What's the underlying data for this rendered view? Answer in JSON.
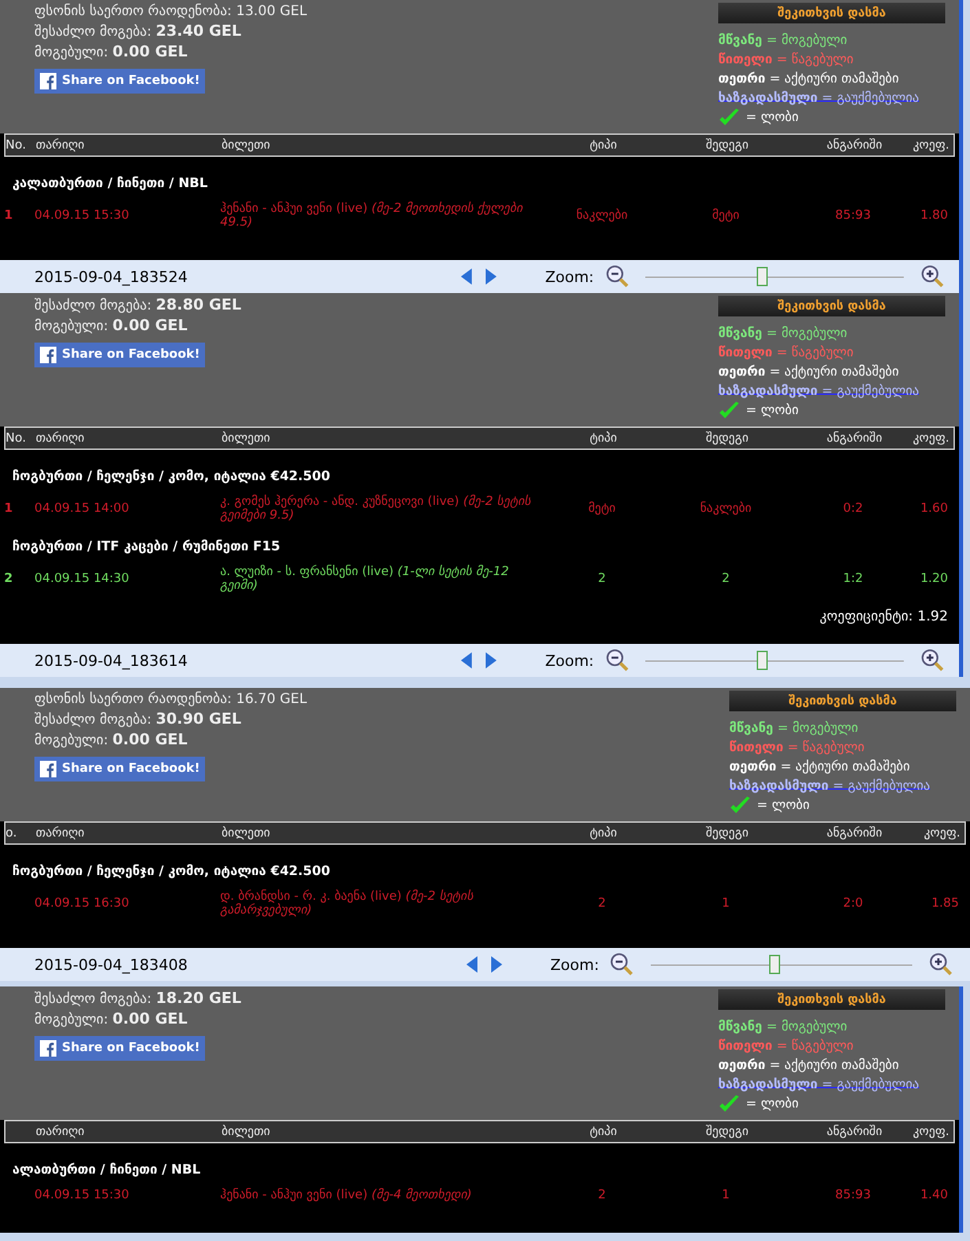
{
  "screens": [
    {
      "summary": [
        {
          "label": "ფსონის საერთო რაოდენობა:",
          "value": "13.00 GEL",
          "bold": false
        },
        {
          "label": "შესაძლო მოგება:",
          "value": "23.40 GEL",
          "bold": true
        },
        {
          "label": "მოგებული:",
          "value": "0.00 GEL",
          "bold": true
        }
      ],
      "share_button": "Share on Facebook!",
      "ask_button": "შეკითხვის დასმა",
      "legend": [
        {
          "kind": "won",
          "term": "მწვანე",
          "desc": "= მოგებული"
        },
        {
          "kind": "lost",
          "term": "წითელი",
          "desc": "= წაგებული"
        },
        {
          "kind": "active",
          "term": "თეთრი",
          "desc": "= აქტიური თამაშები"
        },
        {
          "kind": "void",
          "term": "ხაზგადასმული",
          "desc": "= გაუქმებულია"
        },
        {
          "kind": "check",
          "desc": "= ლობი"
        }
      ],
      "columns": [
        "No.",
        "თარიღი",
        "ბილეთი",
        "ტიპი",
        "შედეგი",
        "ანგარიში",
        "კოეფ."
      ],
      "groups": [
        {
          "title": "კალათბურთი / ჩინეთი / NBL",
          "rows": [
            {
              "color": "#d01c2a",
              "no": "1",
              "date": "04.09.15 15:30",
              "event": "ჰენანი - ანჰუი ვენი (live)",
              "detail": "(მე-2 მეოთხედის ქულები 49.5)",
              "type": "ნაკლები",
              "result": "მეტი",
              "score": "85:93",
              "odds": "1.80"
            }
          ]
        }
      ],
      "footer": {
        "filename": "2015-09-04_183524",
        "zoom_label": "Zoom:",
        "zoom": {
          "level": 0.45
        }
      }
    },
    {
      "summary": [
        {
          "label": "შესაძლო მოგება:",
          "value": "28.80 GEL",
          "bold": true
        },
        {
          "label": "მოგებული:",
          "value": "0.00 GEL",
          "bold": true
        }
      ],
      "share_button": "Share on Facebook!",
      "ask_button": "შეკითხვის დასმა",
      "legend": [
        {
          "kind": "won",
          "term": "მწვანე",
          "desc": "= მოგებული"
        },
        {
          "kind": "lost",
          "term": "წითელი",
          "desc": "= წაგებული"
        },
        {
          "kind": "active",
          "term": "თეთრი",
          "desc": "= აქტიური თამაშები"
        },
        {
          "kind": "void",
          "term": "ხაზგადასმული",
          "desc": "= გაუქმებულია"
        },
        {
          "kind": "check",
          "desc": "= ლობი"
        }
      ],
      "columns": [
        "No.",
        "თარიღი",
        "ბილეთი",
        "ტიპი",
        "შედეგი",
        "ანგარიში",
        "კოეფ."
      ],
      "groups": [
        {
          "title": "ჩოგბურთი / ჩელენჯი / კომო, იტალია €42.500",
          "rows": [
            {
              "color": "#d01c2a",
              "no": "1",
              "date": "04.09.15 14:00",
              "event": "კ. გომეს ჰერერა - ანდ. კუზნეცოვი (live)",
              "detail": "(მე-2 სეტის გეიმები 9.5)",
              "type": "მეტი",
              "result": "ნაკლები",
              "score": "0:2",
              "odds": "1.60"
            }
          ]
        },
        {
          "title": "ჩოგბურთი / ITF კაცები / რუმინეთი F15",
          "rows": [
            {
              "color": "#70dc60",
              "no": "2",
              "date": "04.09.15 14:30",
              "event": "ა. ლუიზი - ს. ფრანსენი (live)",
              "detail": "(1-ლი სეტის მე-12 გეიმი)",
              "type": "2",
              "result": "2",
              "score": "1:2",
              "odds": "1.20"
            }
          ]
        }
      ],
      "total": "კოეფიციენტი: 1.92",
      "footer": {
        "filename": "2015-09-04_183614",
        "zoom_label": "Zoom:",
        "zoom": {
          "level": 0.45
        }
      }
    },
    {
      "summary": [
        {
          "label": "ფსონის საერთო რაოდენობა:",
          "value": "16.70 GEL",
          "bold": false
        },
        {
          "label": "შესაძლო მოგება:",
          "value": "30.90 GEL",
          "bold": true
        },
        {
          "label": "მოგებული:",
          "value": "0.00 GEL",
          "bold": true
        }
      ],
      "share_button": "Share on Facebook!",
      "ask_button": "შეკითხვის დასმა",
      "legend": [
        {
          "kind": "won",
          "term": "მწვანე",
          "desc": "= მოგებული"
        },
        {
          "kind": "lost",
          "term": "წითელი",
          "desc": "= წაგებული"
        },
        {
          "kind": "active",
          "term": "თეთრი",
          "desc": "= აქტიური თამაშები"
        },
        {
          "kind": "void",
          "term": "ხაზგადასმული",
          "desc": "= გაუქმებულია"
        },
        {
          "kind": "check",
          "desc": "= ლობი"
        }
      ],
      "columns": [
        "o.",
        "თარიღი",
        "ბილეთი",
        "ტიპი",
        "შედეგი",
        "ანგარიში",
        "კოეფ."
      ],
      "groups": [
        {
          "title": "ჩოგბურთი / ჩელენჯი / კომო, იტალია €42.500",
          "rows": [
            {
              "color": "#d01c2a",
              "date": "04.09.15 16:30",
              "event": "დ. ბრანდსი - რ. კ. ბაენა (live)",
              "detail": "(მე-2 სეტის გამარჯვებული)",
              "type": "2",
              "result": "1",
              "score": "2:0",
              "odds": "1.85"
            }
          ]
        }
      ],
      "footer": {
        "filename": "2015-09-04_183408",
        "zoom_label": "Zoom:",
        "zoom": {
          "level": 0.47
        }
      }
    },
    {
      "summary": [
        {
          "label": "შესაძლო მოგება:",
          "value": "18.20 GEL",
          "bold": true
        },
        {
          "label": "მოგებული:",
          "value": "0.00 GEL",
          "bold": true
        }
      ],
      "share_button": "Share on Facebook!",
      "ask_button": "შეკითხვის დასმა",
      "legend": [
        {
          "kind": "won",
          "term": "მწვანე",
          "desc": "= მოგებული"
        },
        {
          "kind": "lost",
          "term": "წითელი",
          "desc": "= წაგებული"
        },
        {
          "kind": "active",
          "term": "თეთრი",
          "desc": "= აქტიური თამაშები"
        },
        {
          "kind": "void",
          "term": "ხაზგადასმული",
          "desc": "= გაუქმებულია"
        },
        {
          "kind": "check",
          "desc": "= ლობი"
        }
      ],
      "columns": [
        "",
        "თარიღი",
        "ბილეთი",
        "ტიპი",
        "შედეგი",
        "ანგარიში",
        "კოეფ."
      ],
      "groups": [
        {
          "title": "ალათბურთი / ჩინეთი / NBL",
          "rows": [
            {
              "color": "#d01c2a",
              "date": "04.09.15 15:30",
              "event": "ჰენანი - ანჰუი ვენი (live)",
              "detail": "(მე-4 მეოთხედი)",
              "type": "2",
              "result": "1",
              "score": "85:93",
              "odds": "1.40"
            }
          ]
        }
      ]
    }
  ]
}
